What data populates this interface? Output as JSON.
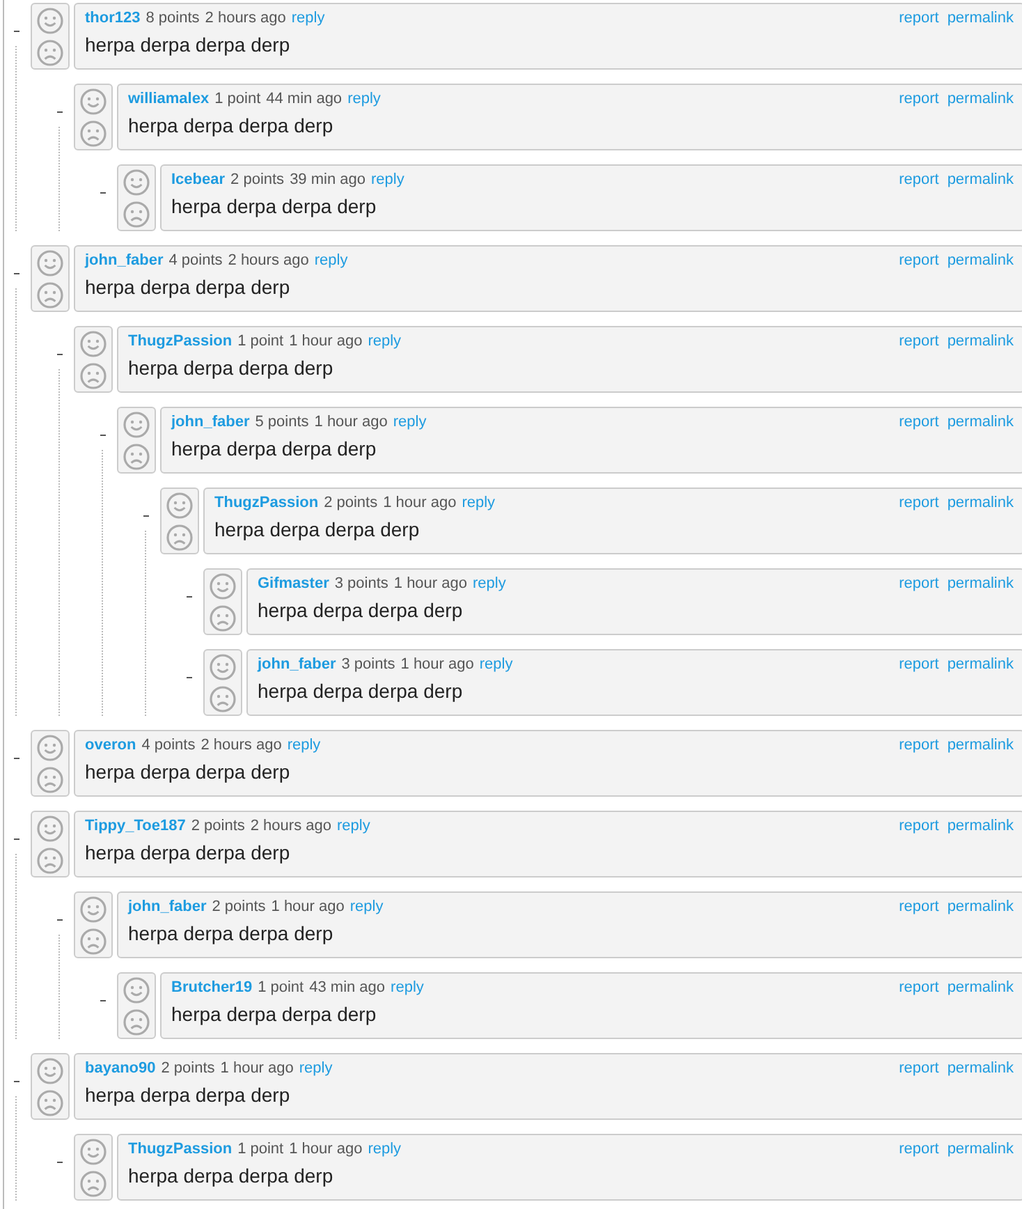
{
  "comments": [
    {
      "author": "thor123",
      "points": "8 points",
      "time": "2 hours ago",
      "reply": "reply",
      "body": "herpa derpa derpa derp",
      "report": "report",
      "permalink": "permalink",
      "children": [
        {
          "author": "williamalex",
          "points": "1 point",
          "time": "44 min ago",
          "reply": "reply",
          "body": "herpa derpa derpa derp",
          "report": "report",
          "permalink": "permalink",
          "children": [
            {
              "author": "Icebear",
              "points": "2 points",
              "time": "39 min ago",
              "reply": "reply",
              "body": "herpa derpa derpa derp",
              "report": "report",
              "permalink": "permalink"
            }
          ]
        }
      ]
    },
    {
      "author": "john_faber",
      "points": "4 points",
      "time": "2 hours ago",
      "reply": "reply",
      "body": "herpa derpa derpa derp",
      "report": "report",
      "permalink": "permalink",
      "children": [
        {
          "author": "ThugzPassion",
          "points": "1 point",
          "time": "1 hour ago",
          "reply": "reply",
          "body": "herpa derpa derpa derp",
          "report": "report",
          "permalink": "permalink",
          "children": [
            {
              "author": "john_faber",
              "points": "5 points",
              "time": "1 hour ago",
              "reply": "reply",
              "body": "herpa derpa derpa derp",
              "report": "report",
              "permalink": "permalink",
              "children": [
                {
                  "author": "ThugzPassion",
                  "points": "2 points",
                  "time": "1 hour ago",
                  "reply": "reply",
                  "body": "herpa derpa derpa derp",
                  "report": "report",
                  "permalink": "permalink",
                  "children": [
                    {
                      "author": "Gifmaster",
                      "points": "3 points",
                      "time": "1 hour ago",
                      "reply": "reply",
                      "body": "herpa derpa derpa derp",
                      "report": "report",
                      "permalink": "permalink"
                    },
                    {
                      "author": "john_faber",
                      "points": "3 points",
                      "time": "1 hour ago",
                      "reply": "reply",
                      "body": "herpa derpa derpa derp",
                      "report": "report",
                      "permalink": "permalink"
                    }
                  ]
                }
              ]
            }
          ]
        }
      ]
    },
    {
      "author": "overon",
      "points": "4 points",
      "time": "2 hours ago",
      "reply": "reply",
      "body": "herpa derpa derpa derp",
      "report": "report",
      "permalink": "permalink"
    },
    {
      "author": "Tippy_Toe187",
      "points": "2 points",
      "time": "2 hours ago",
      "reply": "reply",
      "body": "herpa derpa derpa derp",
      "report": "report",
      "permalink": "permalink",
      "children": [
        {
          "author": "john_faber",
          "points": "2 points",
          "time": "1 hour ago",
          "reply": "reply",
          "body": "herpa derpa derpa derp",
          "report": "report",
          "permalink": "permalink",
          "children": [
            {
              "author": "Brutcher19",
              "points": "1 point",
              "time": "43 min ago",
              "reply": "reply",
              "body": "herpa derpa derpa derp",
              "report": "report",
              "permalink": "permalink"
            }
          ]
        }
      ]
    },
    {
      "author": "bayano90",
      "points": "2 points",
      "time": "1 hour ago",
      "reply": "reply",
      "body": "herpa derpa derpa derp",
      "report": "report",
      "permalink": "permalink",
      "children": [
        {
          "author": "ThugzPassion",
          "points": "1 point",
          "time": "1 hour ago",
          "reply": "reply",
          "body": "herpa derpa derpa derp",
          "report": "report",
          "permalink": "permalink"
        }
      ]
    }
  ]
}
